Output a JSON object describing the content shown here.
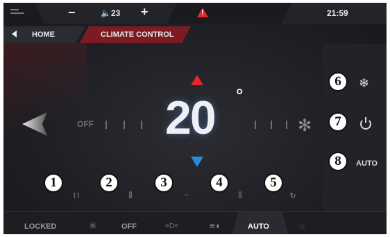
{
  "topbar": {
    "volume_minus": "−",
    "volume_icon": "speaker-icon",
    "volume_value": "23",
    "volume_plus": "+",
    "warning_icon": "warning-triangle-icon",
    "clock": "21:59"
  },
  "breadcrumb": {
    "home_label": "HOME",
    "current_label": "CLIMATE CONTROL"
  },
  "climate": {
    "temperature": "20",
    "unit": "°",
    "fan_off_label": "OFF",
    "up_color": "#e5262b",
    "down_color": "#2b8bd8"
  },
  "right_controls": {
    "ac_icon": "snowflake-icon",
    "power_icon": "power-icon",
    "auto_label": "AUTO"
  },
  "callouts": [
    "1",
    "2",
    "3",
    "4",
    "5",
    "6",
    "7",
    "8"
  ],
  "airflow_icons": [
    "front-defrost-icon",
    "rear-defrost-icon",
    "airflow-body-icon",
    "seat-heat-icon",
    "recirculation-icon"
  ],
  "bottombar": {
    "locked_label": "LOCKED",
    "off_label": "OFF",
    "auto_label": "AUTO"
  }
}
